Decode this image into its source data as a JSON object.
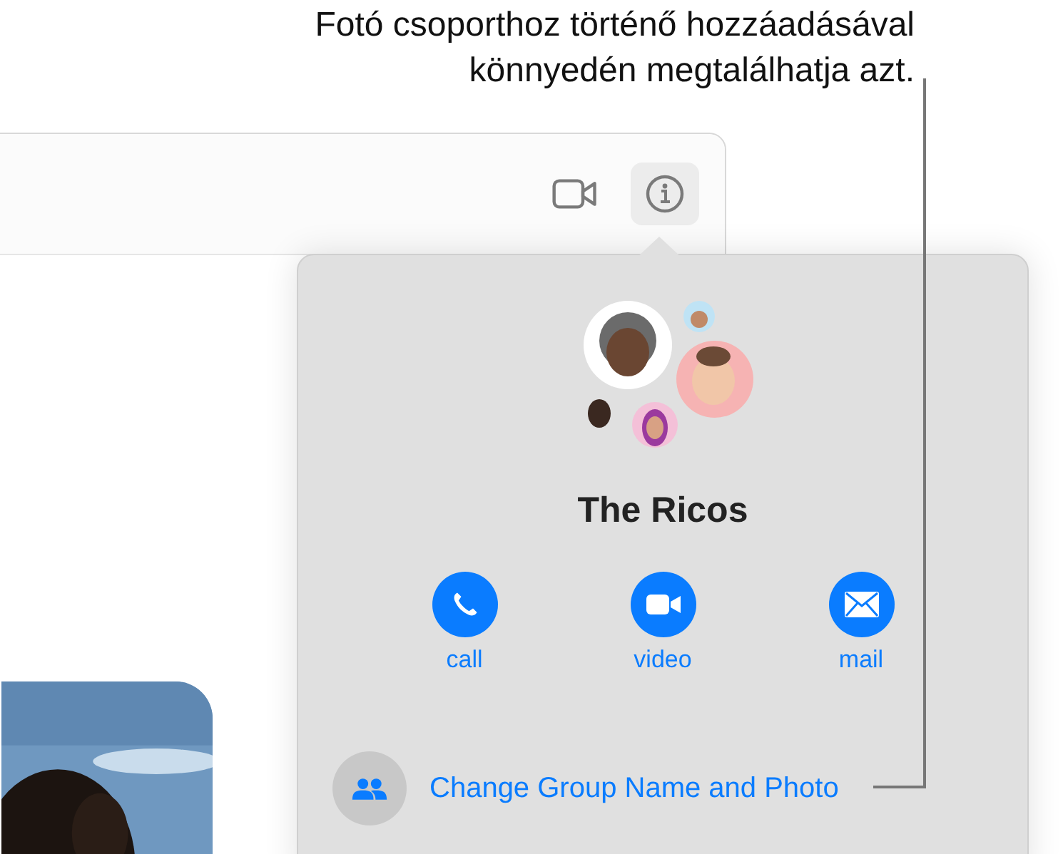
{
  "callout": {
    "text": "Fotó csoporthoz történő hozzáadásával könnyedén megtalálhatja azt."
  },
  "popover": {
    "group_name": "The Ricos",
    "actions": [
      {
        "kind": "call",
        "label": "call"
      },
      {
        "kind": "video",
        "label": "video"
      },
      {
        "kind": "mail",
        "label": "mail"
      }
    ],
    "change_link": "Change Group Name and Photo"
  }
}
